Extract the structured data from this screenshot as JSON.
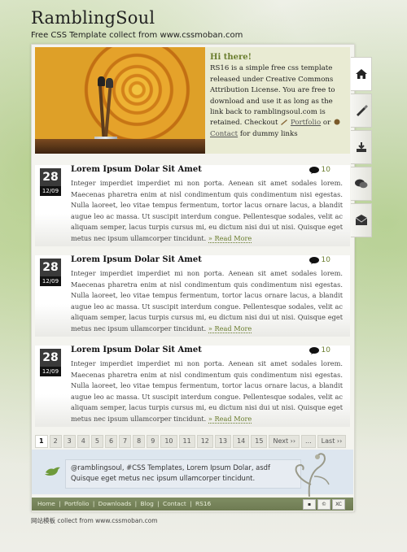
{
  "header": {
    "title": "RamblingSoul",
    "tagline": "Free CSS Template collect from www.cssmoban.com"
  },
  "intro": {
    "heading": "Hi there!",
    "text_before": "RS16 is a simple free css template released under Creative Commons Attribution License. You are free to download and use it as long as the link back to ramblingsoul.com is retained. Checkout",
    "portfolio_link": "Portfolio",
    "or": "or",
    "contact_link": "Contact",
    "text_after": "for dummy links"
  },
  "sidenav": [
    "home-icon",
    "brush-icon",
    "download-icon",
    "chat-icon",
    "mail-icon"
  ],
  "posts": [
    {
      "day": "28",
      "date": "12/09",
      "title": "Lorem Ipsum Dolar Sit Amet",
      "comments": "10",
      "body": "Integer imperdiet imperdiet mi non porta. Aenean sit amet sodales lorem. Maecenas pharetra enim at nisl condimentum quis condimentum nisi egestas. Nulla laoreet, leo vitae tempus fermentum, tortor lacus ornare lacus, a blandit augue leo ac massa. Ut suscipit interdum congue. Pellentesque sodales, velit ac aliquam semper, lacus turpis cursus mi, eu dictum nisi dui ut nisi. Quisque eget metus nec ipsum ullamcorper tincidunt.",
      "read_more": "» Read More"
    },
    {
      "day": "28",
      "date": "12/09",
      "title": "Lorem Ipsum Dolar Sit Amet",
      "comments": "10",
      "body": "Integer imperdiet imperdiet mi non porta. Aenean sit amet sodales lorem. Maecenas pharetra enim at nisl condimentum quis condimentum nisi egestas. Nulla laoreet, leo vitae tempus fermentum, tortor lacus ornare lacus, a blandit augue leo ac massa. Ut suscipit interdum congue. Pellentesque sodales, velit ac aliquam semper, lacus turpis cursus mi, eu dictum nisi dui ut nisi. Quisque eget metus nec ipsum ullamcorper tincidunt.",
      "read_more": "» Read More"
    },
    {
      "day": "28",
      "date": "12/09",
      "title": "Lorem Ipsum Dolar Sit Amet",
      "comments": "10",
      "body": "Integer imperdiet imperdiet mi non porta. Aenean sit amet sodales lorem. Maecenas pharetra enim at nisl condimentum quis condimentum nisi egestas. Nulla laoreet, leo vitae tempus fermentum, tortor lacus ornare lacus, a blandit augue leo ac massa. Ut suscipit interdum congue. Pellentesque sodales, velit ac aliquam semper, lacus turpis cursus mi, eu dictum nisi dui ut nisi. Quisque eget metus nec ipsum ullamcorper tincidunt.",
      "read_more": "» Read More"
    }
  ],
  "pager": {
    "pages": [
      "1",
      "2",
      "3",
      "4",
      "5",
      "6",
      "7",
      "8",
      "9",
      "10",
      "11",
      "12",
      "13",
      "14",
      "15"
    ],
    "current": "1",
    "next": "Next ››",
    "ellipsis": "...",
    "last": "Last ››"
  },
  "tweet": "@ramblingsoul, #CSS Templates, Lorem Ipsum Dolar, asdf Quisque eget metus nec ipsum ullamcorper tincidunt.",
  "footer": {
    "links": [
      "Home",
      "Portfolio",
      "Downloads",
      "Blog",
      "Contact",
      "RS16"
    ],
    "separator": "|",
    "badges": [
      "▪",
      "©",
      "XC"
    ],
    "credit": "网站模板 collect from www.cssmoban.com"
  },
  "colors": {
    "accent": "#6a7d2e",
    "date_box": "#3a3a3a",
    "footer_bar": "#7f8d63"
  }
}
